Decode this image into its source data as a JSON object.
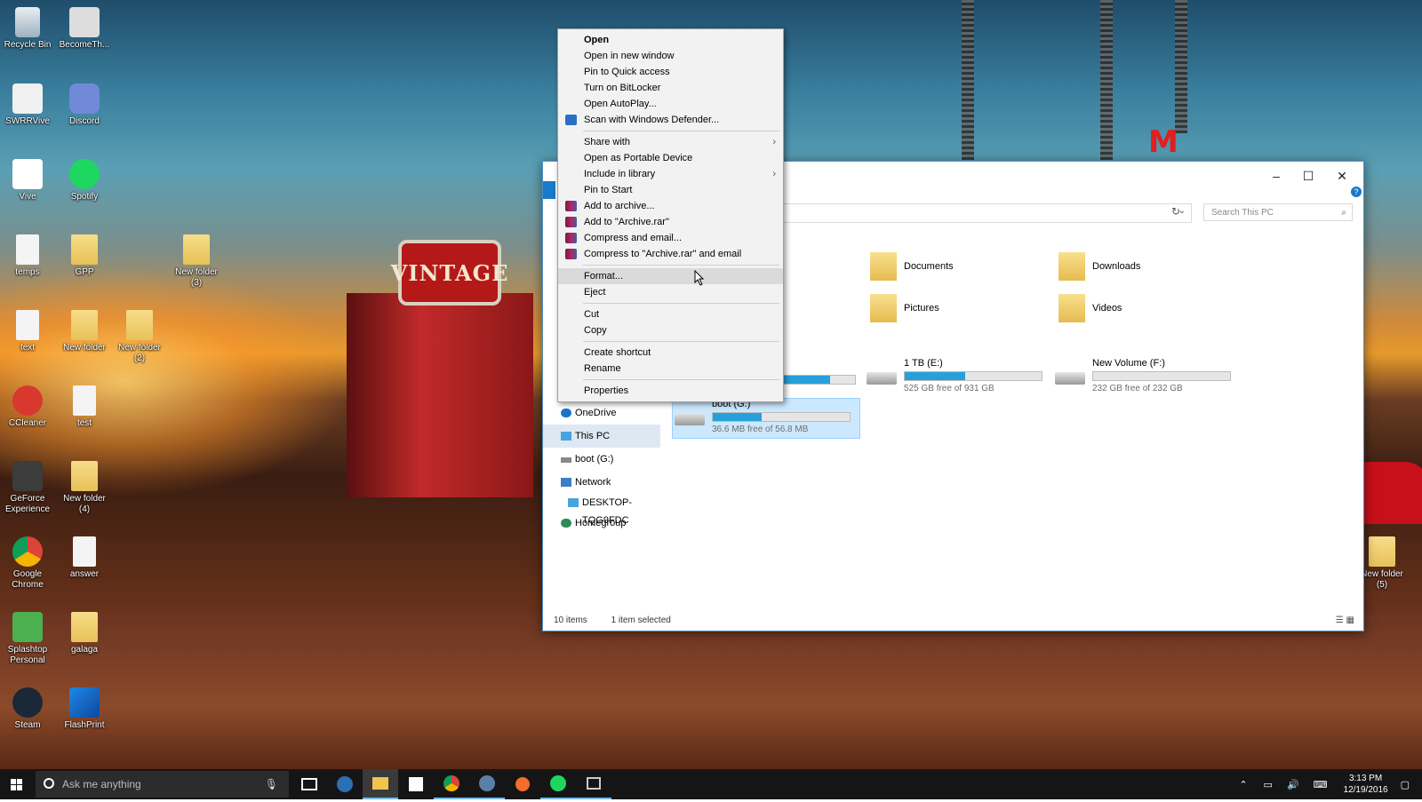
{
  "desktop_icons": [
    {
      "label": "Recycle Bin",
      "icon": "recycle-bin-icon"
    },
    {
      "label": "BecomeTh...",
      "icon": "shortcut-icon"
    },
    {
      "label": "SWRRVive",
      "icon": "app-icon"
    },
    {
      "label": "Discord",
      "icon": "discord-icon"
    },
    {
      "label": "Vive",
      "icon": "vive-icon"
    },
    {
      "label": "Spotify",
      "icon": "spotify-icon"
    },
    {
      "label": "temps",
      "icon": "file-icon"
    },
    {
      "label": "GPP",
      "icon": "folder-icon"
    },
    {
      "label": "New folder (3)",
      "icon": "folder-icon"
    },
    {
      "label": "text",
      "icon": "file-icon"
    },
    {
      "label": "New folder",
      "icon": "folder-icon"
    },
    {
      "label": "New folder (2)",
      "icon": "folder-icon"
    },
    {
      "label": "CCleaner",
      "icon": "ccleaner-icon"
    },
    {
      "label": "test",
      "icon": "file-icon"
    },
    {
      "label": "GeForce Experience",
      "icon": "nvidia-icon"
    },
    {
      "label": "New folder (4)",
      "icon": "folder-icon"
    },
    {
      "label": "Google Chrome",
      "icon": "chrome-icon"
    },
    {
      "label": "answer",
      "icon": "file-icon"
    },
    {
      "label": "Splashtop Personal",
      "icon": "splashtop-icon"
    },
    {
      "label": "galaga",
      "icon": "folder-icon"
    },
    {
      "label": "Steam",
      "icon": "steam-icon"
    },
    {
      "label": "FlashPrint",
      "icon": "flashprint-icon"
    },
    {
      "label": "New folder (5)",
      "icon": "folder-icon"
    }
  ],
  "explorer": {
    "window_controls": {
      "minimize": "–",
      "maximize": "☐",
      "close": "✕"
    },
    "search_placeholder": "Search This PC",
    "folders": [
      {
        "label": "Documents",
        "icon": "documents-folder-icon"
      },
      {
        "label": "Downloads",
        "icon": "downloads-folder-icon"
      },
      {
        "label": "Pictures",
        "icon": "pictures-folder-icon"
      },
      {
        "label": "Videos",
        "icon": "videos-folder-icon"
      }
    ],
    "drives": [
      {
        "name": "",
        "free": "GB",
        "used_fraction": 0.82
      },
      {
        "name": "1 TB (E:)",
        "free": "525 GB free of 931 GB",
        "used_fraction": 0.44
      },
      {
        "name": "New Volume (F:)",
        "free": "232 GB free of 232 GB",
        "used_fraction": 0.0
      },
      {
        "name": "boot (G:)",
        "free": "36.6 MB free of 56.8 MB",
        "used_fraction": 0.36
      }
    ],
    "nav": [
      {
        "label": "OneDrive",
        "icon": "onedrive-icon"
      },
      {
        "label": "This PC",
        "icon": "this-pc-icon"
      },
      {
        "label": "boot (G:)",
        "icon": "drive-icon"
      },
      {
        "label": "Network",
        "icon": "network-icon"
      },
      {
        "label": "DESKTOP-TQG9FDC",
        "icon": "computer-icon"
      },
      {
        "label": "Homegroup",
        "icon": "homegroup-icon"
      }
    ],
    "status": {
      "items": "10 items",
      "selected": "1 item selected"
    }
  },
  "context_menu": {
    "items": [
      {
        "label": "Open"
      },
      {
        "label": "Open in new window"
      },
      {
        "label": "Pin to Quick access"
      },
      {
        "label": "Turn on BitLocker"
      },
      {
        "label": "Open AutoPlay..."
      },
      {
        "label": "Scan with Windows Defender..."
      },
      {
        "label": "Share with"
      },
      {
        "label": "Open as Portable Device"
      },
      {
        "label": "Include in library"
      },
      {
        "label": "Pin to Start"
      },
      {
        "label": "Add to archive..."
      },
      {
        "label": "Add to \"Archive.rar\""
      },
      {
        "label": "Compress and email..."
      },
      {
        "label": "Compress to \"Archive.rar\" and email"
      },
      {
        "label": "Format..."
      },
      {
        "label": "Eject"
      },
      {
        "label": "Cut"
      },
      {
        "label": "Copy"
      },
      {
        "label": "Create shortcut"
      },
      {
        "label": "Rename"
      },
      {
        "label": "Properties"
      }
    ]
  },
  "taskbar": {
    "search_placeholder": "Ask me anything",
    "time": "3:13 PM",
    "date": "12/19/2016",
    "accent": "#76b9ed"
  },
  "wallpaper": {
    "sign_text": "VINTAGE",
    "letter_sign": "M"
  }
}
